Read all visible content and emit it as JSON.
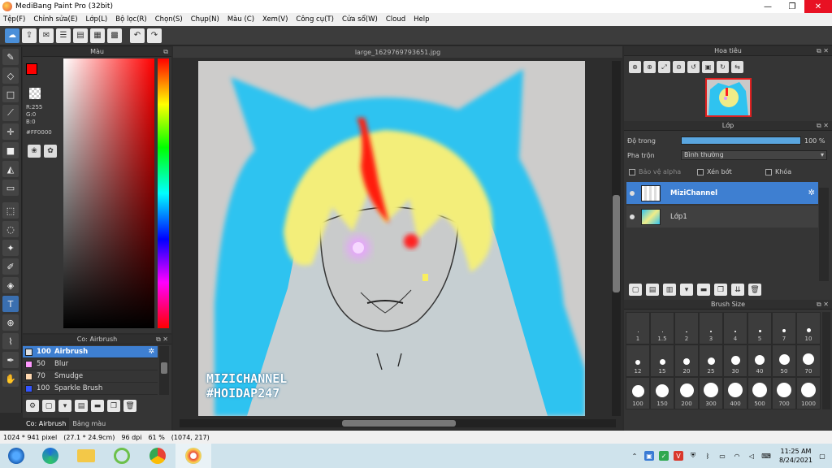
{
  "window": {
    "title": "MediBang Paint Pro (32bit)",
    "controls": [
      "—",
      "❐",
      "✕"
    ]
  },
  "menu": [
    "Tệp(F)",
    "Chỉnh sửa(E)",
    "Lớp(L)",
    "Bộ lọc(R)",
    "Chọn(S)",
    "Chụp(N)",
    "Màu (C)",
    "Xem(V)",
    "Công cụ(T)",
    "Cửa sổ(W)",
    "Cloud",
    "Help"
  ],
  "color_panel": {
    "title": "Màu",
    "r": "R:255",
    "g": "G:0",
    "b": "B:0",
    "hex": "#FF0000",
    "foreground": "#ff0000",
    "background": "#000000"
  },
  "brush_panel": {
    "title": "Co: Airbrush",
    "brushes": [
      {
        "size": "100",
        "name": "Airbrush",
        "color": "#e0e0e0"
      },
      {
        "size": "50",
        "name": "Blur",
        "color": "#ff99ff"
      },
      {
        "size": "70",
        "name": "Smudge",
        "color": "#ffd8b0"
      },
      {
        "size": "100",
        "name": "Sparkle Brush",
        "color": "#3355ff"
      }
    ],
    "tabs": [
      "Co: Airbrush",
      "Bảng màu"
    ]
  },
  "canvas": {
    "tab": "large_1629769793651.jpg",
    "signature_line1": "MIZICHANNEL",
    "signature_line2": "#HOIDAP247"
  },
  "navigator": {
    "title": "Hoa tiêu"
  },
  "layer_panel": {
    "title": "Lớp",
    "opacity_label": "Độ trong",
    "opacity_value": "100 %",
    "opacity_fraction": 1.0,
    "blend_label": "Pha trộn",
    "blend_value": "Bình thường",
    "protect_alpha": "Bảo vệ alpha",
    "clipping": "Xén bớt",
    "lock": "Khóa",
    "layers": [
      {
        "name": "MiziChannel"
      },
      {
        "name": "Lớp1"
      }
    ]
  },
  "brush_size": {
    "title": "Brush Size",
    "sizes": [
      "1",
      "1.5",
      "2",
      "3",
      "4",
      "5",
      "7",
      "10",
      "12",
      "15",
      "20",
      "25",
      "30",
      "40",
      "50",
      "70",
      "100",
      "150",
      "200",
      "300",
      "400",
      "500",
      "700",
      "1000"
    ]
  },
  "status": {
    "pixels": "1024 * 941 pixel",
    "cm": "(27.1 * 24.9cm)",
    "dpi": "96 dpi",
    "zoom": "61 %",
    "cursor": "(1074, 217)"
  },
  "taskbar": {
    "time": "11:25 AM",
    "date": "8/24/2021"
  }
}
